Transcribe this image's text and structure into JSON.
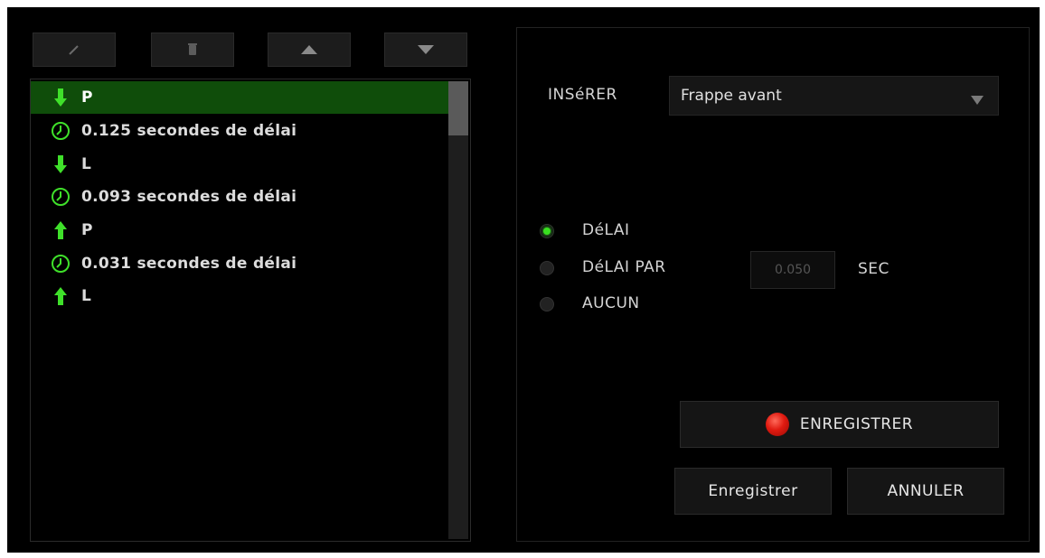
{
  "toolbar": {
    "buttons": [
      {
        "icon": "pencil-icon"
      },
      {
        "icon": "trash-icon"
      },
      {
        "icon": "move-up-icon"
      },
      {
        "icon": "move-down-icon"
      }
    ]
  },
  "macro_list": {
    "items": [
      {
        "icon": "key-down-arrow-icon",
        "text": "P",
        "selected": true
      },
      {
        "icon": "clock-icon",
        "text": "0.125 secondes de délai"
      },
      {
        "icon": "key-down-arrow-icon",
        "text": "L"
      },
      {
        "icon": "clock-icon",
        "text": "0.093 secondes de délai"
      },
      {
        "icon": "key-up-arrow-icon",
        "text": "P"
      },
      {
        "icon": "clock-icon",
        "text": "0.031 secondes de délai"
      },
      {
        "icon": "key-up-arrow-icon",
        "text": "L"
      }
    ]
  },
  "insert": {
    "label": "INSéRER",
    "selected": "Frappe avant"
  },
  "delay_options": {
    "options": [
      {
        "label": "DéLAI",
        "checked": true
      },
      {
        "label": "DéLAI PAR",
        "checked": false
      },
      {
        "label": "AUCUN",
        "checked": false
      }
    ],
    "value": "0.050",
    "unit": "SEC"
  },
  "record_button": {
    "label": "ENREGISTRER"
  },
  "save_button": {
    "label": "Enregistrer"
  },
  "cancel_button": {
    "label": "ANNULER"
  },
  "colors": {
    "accent": "#39e020",
    "selected_row": "#0f4d0a",
    "record": "#e01a10"
  }
}
